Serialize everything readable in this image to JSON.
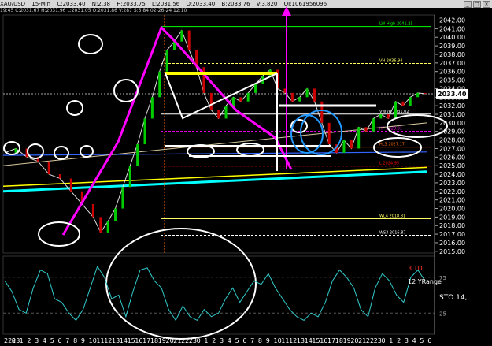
{
  "window": {
    "symbol": "XAU/USD",
    "timeframe": "15-Min",
    "title_values": [
      "C:2033.40",
      "N:2.38",
      "H:2033.75",
      "L:2031.56",
      "O:2033.40",
      "B:2033.76",
      "V:3,820",
      "OI:1061956096"
    ],
    "info_text": "19:45  C:2031.67  H:2031.96  L:2031.05  O:2031.86  V:287  S:5.84  02-26-24  12:10"
  },
  "chart_data": {
    "type": "line",
    "price_axis": {
      "ticks": [
        2042.0,
        2041.0,
        2040.0,
        2039.0,
        2038.0,
        2037.0,
        2036.0,
        2035.0,
        2034.0,
        2033.0,
        2032.0,
        2031.0,
        2030.0,
        2029.0,
        2028.0,
        2027.0,
        2026.0,
        2025.0,
        2024.0,
        2023.0,
        2022.0,
        2021.0,
        2020.0,
        2019.0,
        2018.0,
        2017.0,
        2016.0,
        2015.0
      ],
      "range": [
        2014.8,
        2042.6
      ],
      "last_price": "2033.40"
    },
    "time_axis": {
      "labels": [
        "2223",
        "0",
        "1",
        "2",
        "3",
        "4",
        "5",
        "6",
        "7",
        "8",
        "9",
        "10",
        "11",
        "12",
        "13",
        "14",
        "15",
        "16",
        "17",
        "18",
        "19",
        "20",
        "21",
        "22",
        "23",
        "0",
        "1",
        "2",
        "3",
        "4",
        "5",
        "6",
        "7",
        "8",
        "9",
        "10",
        "11",
        "12",
        "13",
        "14",
        "15",
        "16",
        "17",
        "18",
        "19",
        "20",
        "21",
        "22",
        "23",
        "0",
        "1",
        "2",
        "3",
        "4",
        "5",
        "6"
      ]
    },
    "price_series": [
      {
        "x": 0,
        "y": 2026.5
      },
      {
        "x": 3,
        "y": 2027.0
      },
      {
        "x": 6,
        "y": 2026.0
      },
      {
        "x": 9,
        "y": 2025.5
      },
      {
        "x": 12,
        "y": 2024.0
      },
      {
        "x": 15,
        "y": 2023.5
      },
      {
        "x": 18,
        "y": 2022.0
      },
      {
        "x": 21,
        "y": 2020.5
      },
      {
        "x": 24,
        "y": 2019.0
      },
      {
        "x": 26,
        "y": 2017.2
      },
      {
        "x": 28,
        "y": 2018.5
      },
      {
        "x": 30,
        "y": 2020.0
      },
      {
        "x": 32,
        "y": 2022.5
      },
      {
        "x": 34,
        "y": 2025.0
      },
      {
        "x": 36,
        "y": 2027.5
      },
      {
        "x": 38,
        "y": 2030.5
      },
      {
        "x": 40,
        "y": 2033.0
      },
      {
        "x": 42,
        "y": 2036.0
      },
      {
        "x": 44,
        "y": 2038.5
      },
      {
        "x": 46,
        "y": 2039.5
      },
      {
        "x": 48,
        "y": 2040.8
      },
      {
        "x": 50,
        "y": 2038.5
      },
      {
        "x": 52,
        "y": 2036.5
      },
      {
        "x": 54,
        "y": 2033.5
      },
      {
        "x": 56,
        "y": 2031.5
      },
      {
        "x": 58,
        "y": 2030.5
      },
      {
        "x": 60,
        "y": 2032.0
      },
      {
        "x": 62,
        "y": 2033.0
      },
      {
        "x": 64,
        "y": 2032.5
      },
      {
        "x": 66,
        "y": 2033.5
      },
      {
        "x": 68,
        "y": 2034.5
      },
      {
        "x": 70,
        "y": 2035.5
      },
      {
        "x": 72,
        "y": 2036.2
      },
      {
        "x": 74,
        "y": 2034.0
      },
      {
        "x": 76,
        "y": 2033.5
      },
      {
        "x": 78,
        "y": 2032.5
      },
      {
        "x": 80,
        "y": 2033.0
      },
      {
        "x": 82,
        "y": 2034.0
      },
      {
        "x": 84,
        "y": 2032.5
      },
      {
        "x": 86,
        "y": 2030.0
      },
      {
        "x": 88,
        "y": 2027.5
      },
      {
        "x": 90,
        "y": 2026.5
      },
      {
        "x": 92,
        "y": 2028.0
      },
      {
        "x": 94,
        "y": 2027.0
      },
      {
        "x": 96,
        "y": 2029.5
      },
      {
        "x": 98,
        "y": 2029.0
      },
      {
        "x": 100,
        "y": 2030.5
      },
      {
        "x": 102,
        "y": 2031.0
      },
      {
        "x": 104,
        "y": 2030.5
      },
      {
        "x": 106,
        "y": 2032.5
      },
      {
        "x": 108,
        "y": 2032.0
      },
      {
        "x": 110,
        "y": 2033.0
      },
      {
        "x": 112,
        "y": 2033.5
      },
      {
        "x": 114,
        "y": 2033.4
      }
    ],
    "levels": [
      {
        "label": "LW High  2041.25",
        "value": 2041.25,
        "color": "#00ff00"
      },
      {
        "label": "VH  2036.94",
        "value": 2036.94,
        "color": "#ffff66"
      },
      {
        "label": "VWVR  2031.02",
        "value": 2031.02,
        "color": "#ffffff"
      },
      {
        "label": "HP  2029.01",
        "value": 2029.01,
        "color": "#ff00ff"
      },
      {
        "label": "HL3  2027.17",
        "value": 2027.17,
        "color": "#ff6600"
      },
      {
        "label": "L  2024.95",
        "value": 2024.95,
        "color": "#ff0000"
      },
      {
        "label": "WL4  2018.81",
        "value": 2018.81,
        "color": "#ffff66"
      },
      {
        "label": "WS3  2016.87",
        "value": 2016.87,
        "color": "#ffffff"
      }
    ],
    "oscillator": {
      "name": "STO",
      "value_label": "14,",
      "levels_labels": [
        "75",
        "25"
      ],
      "note_red": "3 TD",
      "note_white": "12 YRange",
      "series": [
        70,
        55,
        30,
        25,
        60,
        85,
        80,
        45,
        40,
        25,
        15,
        30,
        60,
        90,
        75,
        45,
        50,
        20,
        55,
        85,
        88,
        70,
        60,
        30,
        15,
        35,
        20,
        15,
        30,
        20,
        25,
        45,
        60,
        40,
        55,
        70,
        65,
        80,
        60,
        45,
        30,
        20,
        15,
        25,
        20,
        40,
        70,
        85,
        75,
        60,
        30,
        20,
        60,
        80,
        70,
        50,
        40,
        75,
        85,
        70
      ]
    }
  }
}
